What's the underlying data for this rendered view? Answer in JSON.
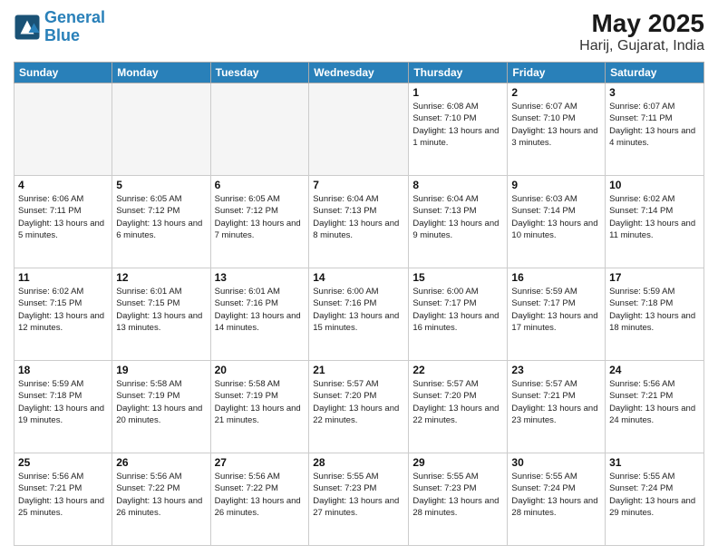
{
  "header": {
    "logo_line1": "General",
    "logo_line2": "Blue",
    "month_year": "May 2025",
    "location": "Harij, Gujarat, India"
  },
  "weekdays": [
    "Sunday",
    "Monday",
    "Tuesday",
    "Wednesday",
    "Thursday",
    "Friday",
    "Saturday"
  ],
  "weeks": [
    [
      {
        "day": "",
        "empty": true
      },
      {
        "day": "",
        "empty": true
      },
      {
        "day": "",
        "empty": true
      },
      {
        "day": "",
        "empty": true
      },
      {
        "day": "1",
        "sunrise": "6:08 AM",
        "sunset": "7:10 PM",
        "daylight": "13 hours and 1 minute."
      },
      {
        "day": "2",
        "sunrise": "6:07 AM",
        "sunset": "7:10 PM",
        "daylight": "13 hours and 3 minutes."
      },
      {
        "day": "3",
        "sunrise": "6:07 AM",
        "sunset": "7:11 PM",
        "daylight": "13 hours and 4 minutes."
      }
    ],
    [
      {
        "day": "4",
        "sunrise": "6:06 AM",
        "sunset": "7:11 PM",
        "daylight": "13 hours and 5 minutes."
      },
      {
        "day": "5",
        "sunrise": "6:05 AM",
        "sunset": "7:12 PM",
        "daylight": "13 hours and 6 minutes."
      },
      {
        "day": "6",
        "sunrise": "6:05 AM",
        "sunset": "7:12 PM",
        "daylight": "13 hours and 7 minutes."
      },
      {
        "day": "7",
        "sunrise": "6:04 AM",
        "sunset": "7:13 PM",
        "daylight": "13 hours and 8 minutes."
      },
      {
        "day": "8",
        "sunrise": "6:04 AM",
        "sunset": "7:13 PM",
        "daylight": "13 hours and 9 minutes."
      },
      {
        "day": "9",
        "sunrise": "6:03 AM",
        "sunset": "7:14 PM",
        "daylight": "13 hours and 10 minutes."
      },
      {
        "day": "10",
        "sunrise": "6:02 AM",
        "sunset": "7:14 PM",
        "daylight": "13 hours and 11 minutes."
      }
    ],
    [
      {
        "day": "11",
        "sunrise": "6:02 AM",
        "sunset": "7:15 PM",
        "daylight": "13 hours and 12 minutes."
      },
      {
        "day": "12",
        "sunrise": "6:01 AM",
        "sunset": "7:15 PM",
        "daylight": "13 hours and 13 minutes."
      },
      {
        "day": "13",
        "sunrise": "6:01 AM",
        "sunset": "7:16 PM",
        "daylight": "13 hours and 14 minutes."
      },
      {
        "day": "14",
        "sunrise": "6:00 AM",
        "sunset": "7:16 PM",
        "daylight": "13 hours and 15 minutes."
      },
      {
        "day": "15",
        "sunrise": "6:00 AM",
        "sunset": "7:17 PM",
        "daylight": "13 hours and 16 minutes."
      },
      {
        "day": "16",
        "sunrise": "5:59 AM",
        "sunset": "7:17 PM",
        "daylight": "13 hours and 17 minutes."
      },
      {
        "day": "17",
        "sunrise": "5:59 AM",
        "sunset": "7:18 PM",
        "daylight": "13 hours and 18 minutes."
      }
    ],
    [
      {
        "day": "18",
        "sunrise": "5:59 AM",
        "sunset": "7:18 PM",
        "daylight": "13 hours and 19 minutes."
      },
      {
        "day": "19",
        "sunrise": "5:58 AM",
        "sunset": "7:19 PM",
        "daylight": "13 hours and 20 minutes."
      },
      {
        "day": "20",
        "sunrise": "5:58 AM",
        "sunset": "7:19 PM",
        "daylight": "13 hours and 21 minutes."
      },
      {
        "day": "21",
        "sunrise": "5:57 AM",
        "sunset": "7:20 PM",
        "daylight": "13 hours and 22 minutes."
      },
      {
        "day": "22",
        "sunrise": "5:57 AM",
        "sunset": "7:20 PM",
        "daylight": "13 hours and 22 minutes."
      },
      {
        "day": "23",
        "sunrise": "5:57 AM",
        "sunset": "7:21 PM",
        "daylight": "13 hours and 23 minutes."
      },
      {
        "day": "24",
        "sunrise": "5:56 AM",
        "sunset": "7:21 PM",
        "daylight": "13 hours and 24 minutes."
      }
    ],
    [
      {
        "day": "25",
        "sunrise": "5:56 AM",
        "sunset": "7:21 PM",
        "daylight": "13 hours and 25 minutes."
      },
      {
        "day": "26",
        "sunrise": "5:56 AM",
        "sunset": "7:22 PM",
        "daylight": "13 hours and 26 minutes."
      },
      {
        "day": "27",
        "sunrise": "5:56 AM",
        "sunset": "7:22 PM",
        "daylight": "13 hours and 26 minutes."
      },
      {
        "day": "28",
        "sunrise": "5:55 AM",
        "sunset": "7:23 PM",
        "daylight": "13 hours and 27 minutes."
      },
      {
        "day": "29",
        "sunrise": "5:55 AM",
        "sunset": "7:23 PM",
        "daylight": "13 hours and 28 minutes."
      },
      {
        "day": "30",
        "sunrise": "5:55 AM",
        "sunset": "7:24 PM",
        "daylight": "13 hours and 28 minutes."
      },
      {
        "day": "31",
        "sunrise": "5:55 AM",
        "sunset": "7:24 PM",
        "daylight": "13 hours and 29 minutes."
      }
    ]
  ]
}
